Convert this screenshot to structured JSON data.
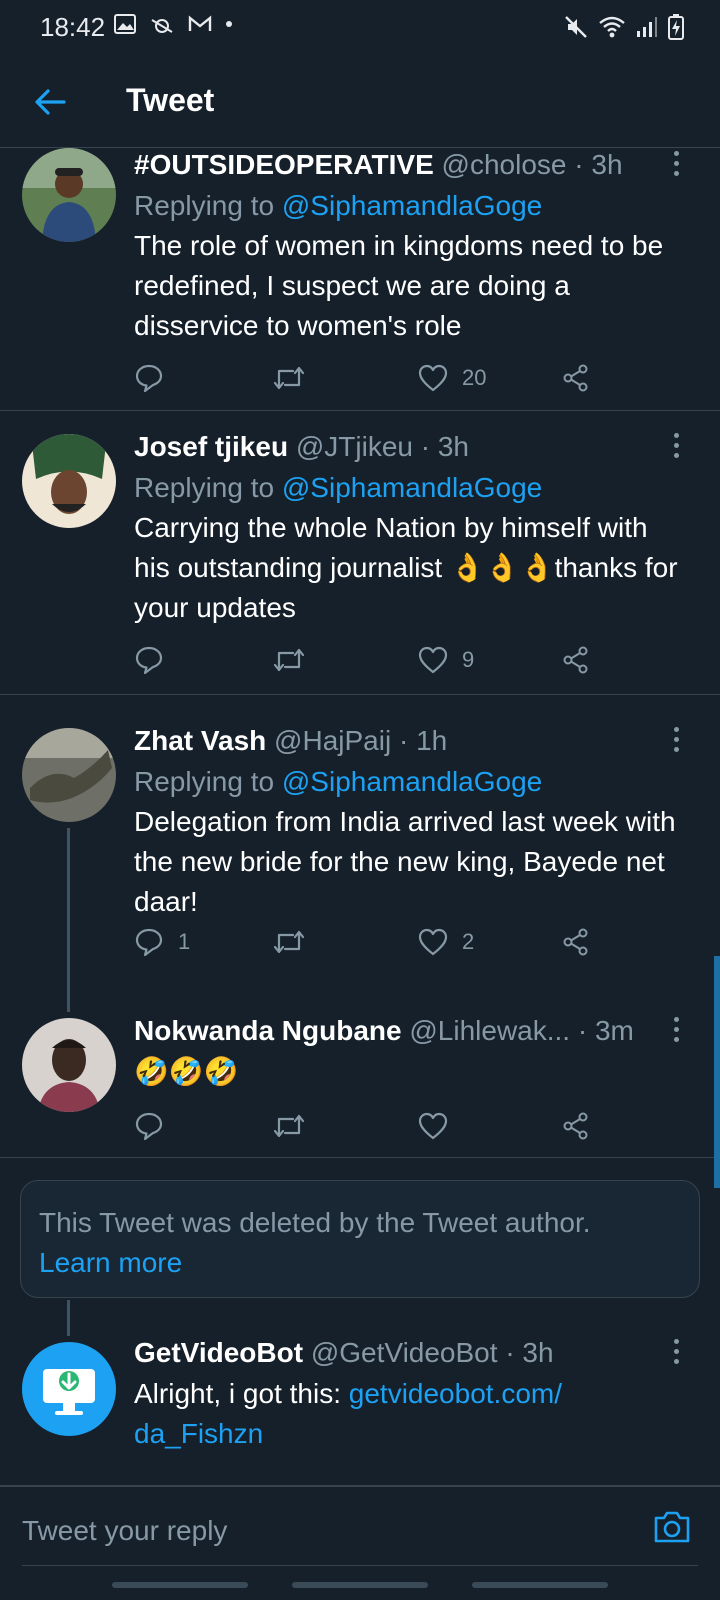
{
  "status_bar": {
    "time": "18:42"
  },
  "header": {
    "title": "Tweet"
  },
  "tweets": [
    {
      "name": "#OUTSIDEOPERATIVE",
      "handle": "@cholose",
      "time": "· 3h",
      "replying_label": "Replying to",
      "replying_to": "@SiphamandlaGoge",
      "text": "The role of women in kingdoms need to be redefined, I suspect we are doing a disservice to women's role",
      "likes": "20"
    },
    {
      "name": "Josef tjikeu",
      "handle": "@JTjikeu",
      "time": "· 3h",
      "replying_label": "Replying to",
      "replying_to": "@SiphamandlaGoge",
      "text_a": "Carrying the whole Nation by himself with his outstanding journalist ",
      "emoji": "👌👌👌",
      "text_b": "thanks for your updates",
      "likes": "9"
    },
    {
      "name": "Zhat Vash",
      "handle": "@HajPaij",
      "time": "· 1h",
      "replying_label": "Replying to",
      "replying_to": "@SiphamandlaGoge",
      "text": "Delegation from India arrived last week with the new bride for the new king, Bayede net daar!",
      "replies": "1",
      "likes": "2"
    },
    {
      "name": "Nokwanda Ngubane",
      "handle": "@Lihlewak...",
      "time": "· 3m",
      "emoji": "🤣🤣🤣"
    }
  ],
  "deleted": {
    "text": "This Tweet was deleted by the Tweet author.",
    "learn_more": "Learn more"
  },
  "bot_tweet": {
    "name": "GetVideoBot",
    "handle": "@GetVideoBot",
    "time": "· 3h",
    "text": "Alright, i got this: ",
    "link_a": "getvideobot.com/",
    "link_b": "da_Fishzn"
  },
  "reply_bar": {
    "placeholder": "Tweet your reply"
  },
  "colors": {
    "background": "#15202b",
    "accent": "#1da1f2",
    "muted": "#8899a6",
    "divider": "#38444d"
  }
}
